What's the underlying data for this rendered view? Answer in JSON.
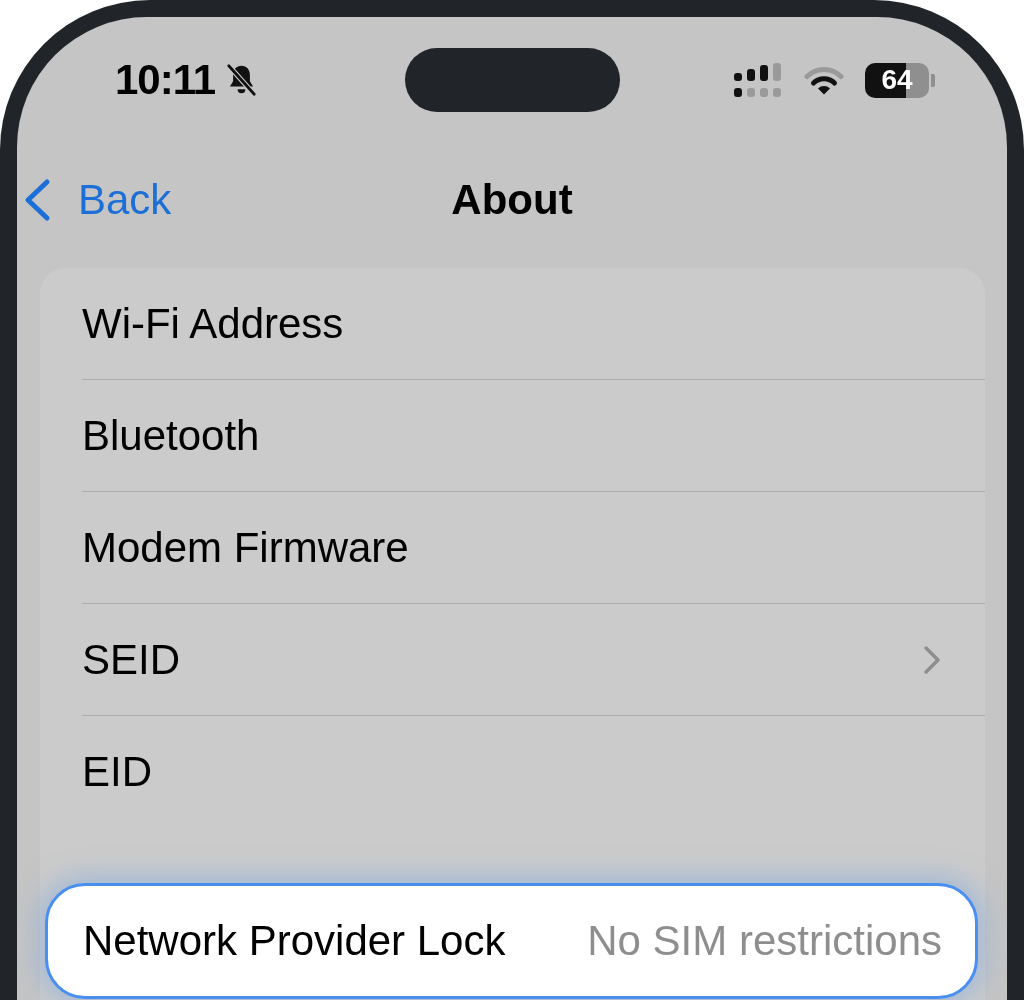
{
  "status_bar": {
    "time": "10:11",
    "silent": true,
    "battery": "64"
  },
  "nav": {
    "back": "Back",
    "title": "About"
  },
  "rows": [
    {
      "label": "Wi-Fi Address",
      "kind": "info",
      "highlighted": false
    },
    {
      "label": "Bluetooth",
      "kind": "info",
      "highlighted": false
    },
    {
      "label": "Modem Firmware",
      "kind": "info",
      "highlighted": false
    },
    {
      "label": "SEID",
      "kind": "detail",
      "highlighted": false
    },
    {
      "label": "EID",
      "kind": "info",
      "highlighted": false
    },
    {
      "label": "Network Provider Lock",
      "value": "No SIM restrictions",
      "kind": "info",
      "highlighted": true
    }
  ]
}
